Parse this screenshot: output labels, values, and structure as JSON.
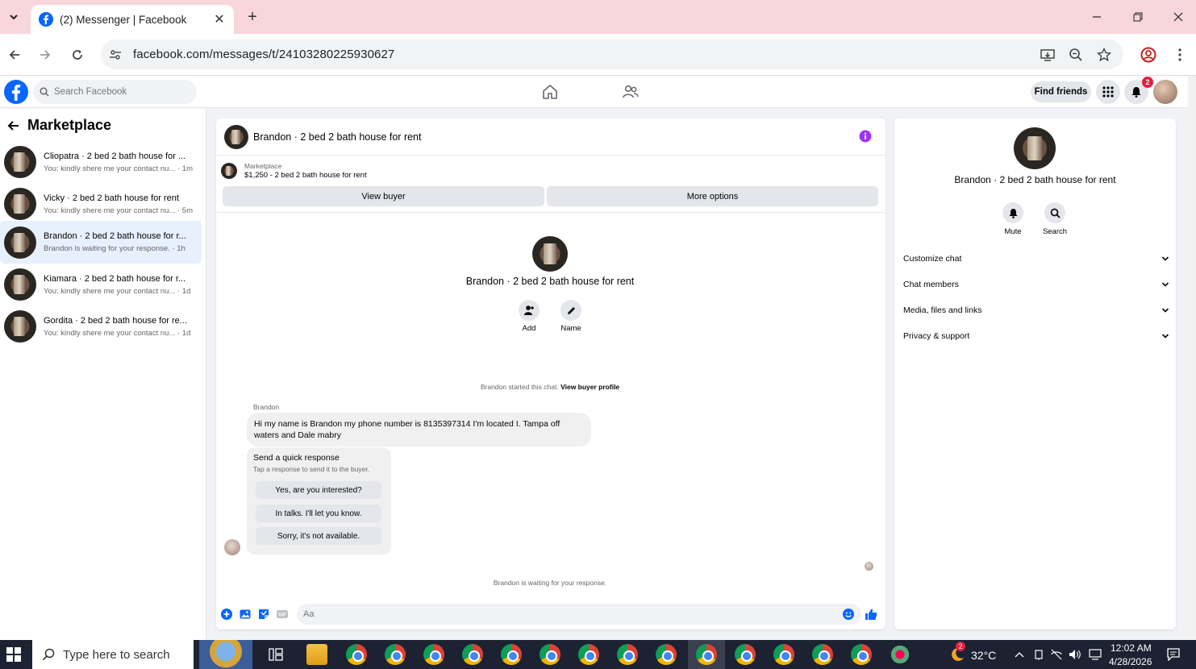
{
  "browser": {
    "tab_title": "(2) Messenger | Facebook",
    "url": "facebook.com/messages/t/24103280225930627"
  },
  "fb_header": {
    "search_placeholder": "Search Facebook",
    "find_friends": "Find friends",
    "notification_count": "2",
    "brand_color": "#0866ff"
  },
  "sidebar": {
    "title": "Marketplace",
    "conversations": [
      {
        "name": "Cliopatra · 2 bed 2 bath house for ...",
        "preview": "You: kindly shere me your contact nu... · 1m"
      },
      {
        "name": "Vicky · 2 bed 2 bath house for rent",
        "preview": "You: kindly shere me your contact nu... · 5m"
      },
      {
        "name": "Brandon · 2 bed 2 bath house for r...",
        "preview": "Brandon is waiting for your response. · 1h"
      },
      {
        "name": "Kiamara · 2 bed 2 bath house for r...",
        "preview": "You: kindly shere me your contact nu... · 1d"
      },
      {
        "name": "Gordita · 2 bed 2 bath house for re...",
        "preview": "You: kindly shere me your contact nu... · 1d"
      }
    ]
  },
  "chat": {
    "header_name": "Brandon · 2 bed 2 bath house for rent",
    "listing_category": "Marketplace",
    "listing_price_title": "$1,250 - 2 bed 2 bath house for rent",
    "view_buyer": "View buyer",
    "more_options": "More options",
    "center_name": "Brandon · 2 bed 2 bath house for rent",
    "add_label": "Add",
    "name_label": "Name",
    "started_text": "Brandon started this chat.",
    "view_buyer_profile": "View buyer profile",
    "sender_label": "Brandon",
    "message": "Hi my name is Brandon my phone number is 8135397314 I'm located I. Tampa off waters and Dale mabry",
    "quick_title": "Send a quick response",
    "quick_subtitle": "Tap a response to send it to the buyer.",
    "quick_responses": [
      "Yes, are you interested?",
      "In talks. I'll let you know.",
      "Sorry, it's not available."
    ],
    "waiting_text": "Brandon is waiting for your response.",
    "composer_placeholder": "Aa"
  },
  "right_panel": {
    "name": "Brandon · 2 bed 2 bath house for rent",
    "mute": "Mute",
    "search": "Search",
    "sections": [
      "Customize chat",
      "Chat members",
      "Media, files and links",
      "Privacy & support"
    ]
  },
  "taskbar": {
    "search_placeholder": "Type here to search",
    "weather_badge": "2",
    "temperature": "32°C",
    "time": "12:02 AM",
    "date": "4/28/2026"
  }
}
